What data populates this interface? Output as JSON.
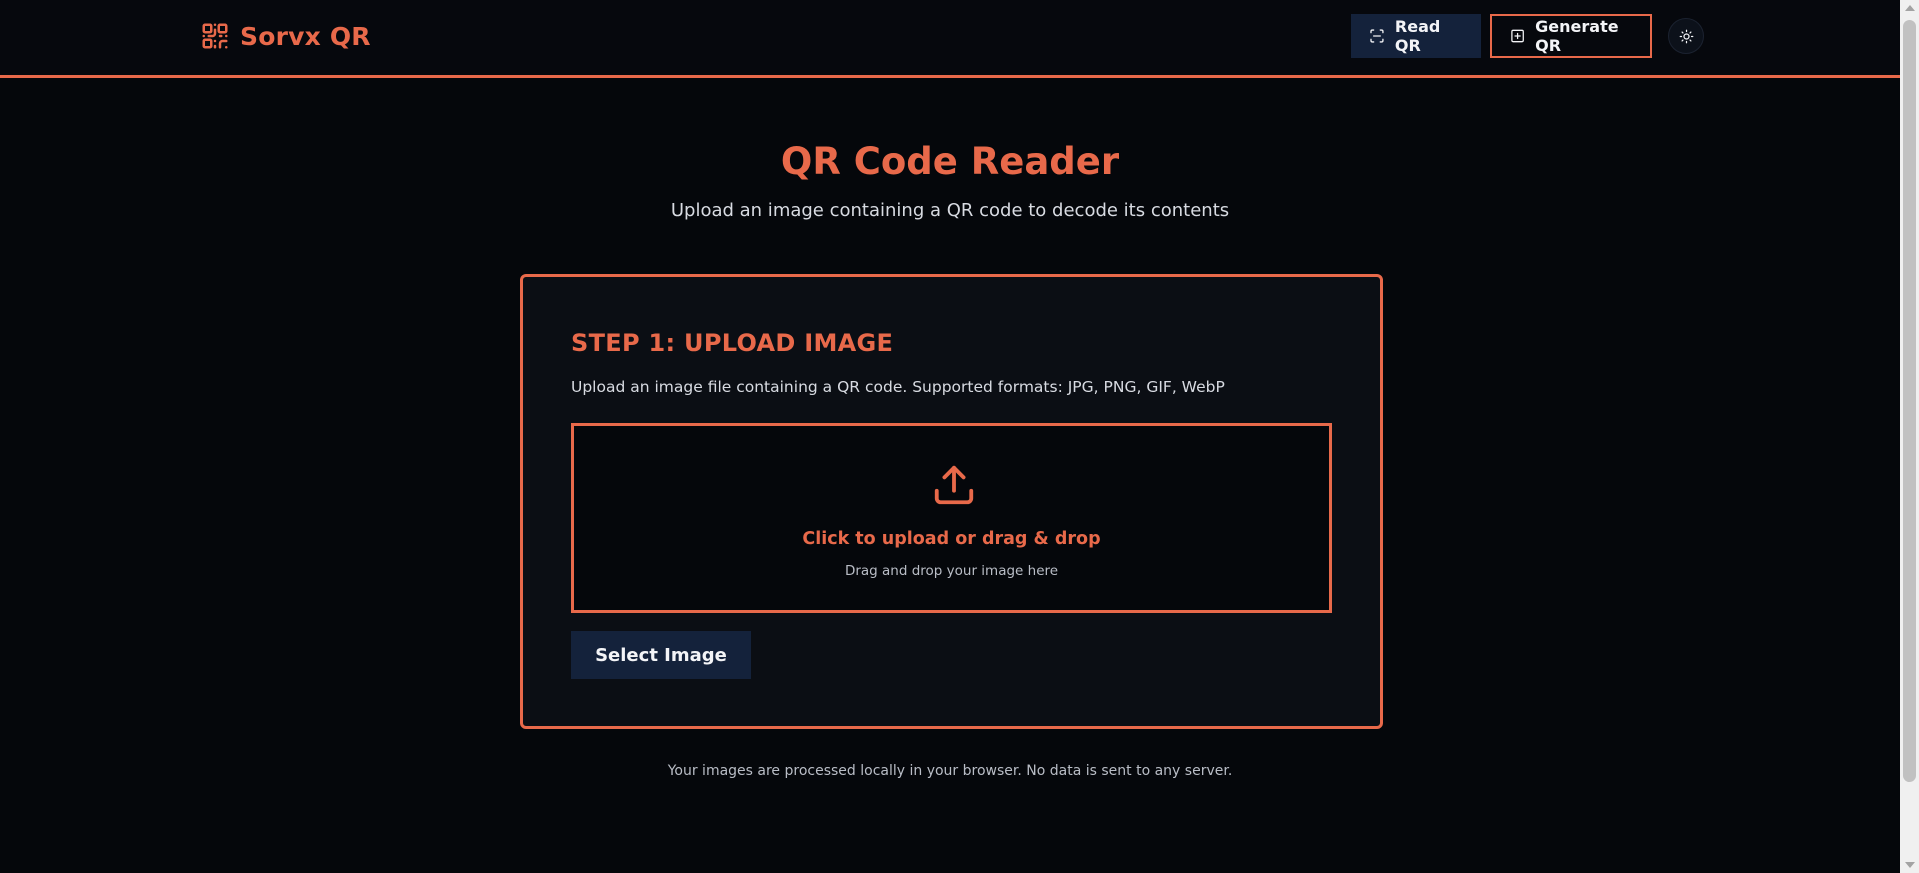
{
  "header": {
    "brand_name": "Sorvx QR",
    "brand_icon": "qr-code-icon",
    "nav": {
      "read_label": "Read QR",
      "read_icon": "scan-icon",
      "generate_label": "Generate QR",
      "generate_icon": "plus-square-icon",
      "theme_icon": "sun-icon"
    }
  },
  "hero": {
    "title": "QR Code Reader",
    "subtitle": "Upload an image containing a QR code to decode its contents"
  },
  "step": {
    "title": "STEP 1: UPLOAD IMAGE",
    "description": "Upload an image file containing a QR code. Supported formats: JPG, PNG, GIF, WebP",
    "dropzone": {
      "icon": "upload-icon",
      "title": "Click to upload or drag & drop",
      "subtitle": "Drag and drop your image here"
    },
    "select_label": "Select Image"
  },
  "footer": {
    "note": "Your images are processed locally in your browser. No data is sent to any server."
  },
  "colors": {
    "accent": "#e8694a",
    "background": "#05070b",
    "button_navy": "#14223b"
  }
}
